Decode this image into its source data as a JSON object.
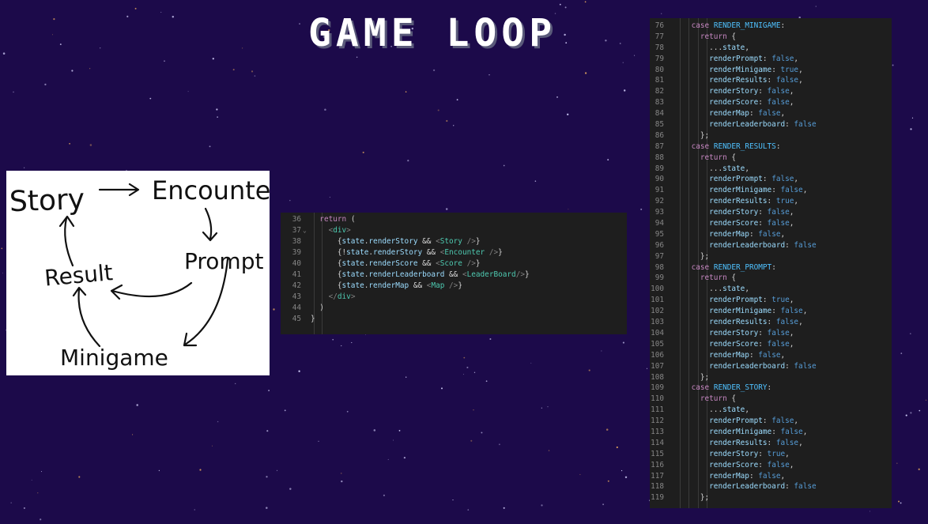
{
  "slide": {
    "title": "GAME LOOP"
  },
  "sketch": {
    "labels": {
      "story": "Story",
      "encounter": "Encounter",
      "prompt": "Prompt",
      "result": "Result",
      "minigame": "Minigame"
    }
  },
  "snippet_small": {
    "lines": [
      {
        "n": "36",
        "t": "  return ("
      },
      {
        "n": "37",
        "t": "    <div>"
      },
      {
        "n": "38",
        "t": "      {state.renderStory && <Story />}"
      },
      {
        "n": "39",
        "t": "      {!state.renderStory && <Encounter />}"
      },
      {
        "n": "40",
        "t": "      {state.renderScore && <Score />}"
      },
      {
        "n": "41",
        "t": "      {state.renderLeaderboard && <LeaderBoard/>}"
      },
      {
        "n": "42",
        "t": "      {state.renderMap && <Map />}"
      },
      {
        "n": "43",
        "t": "    </div>"
      },
      {
        "n": "44",
        "t": "  )"
      },
      {
        "n": "45",
        "t": "}"
      }
    ]
  },
  "snippet_large": {
    "lines": [
      {
        "n": "76",
        "t": "    case RENDER_MINIGAME:"
      },
      {
        "n": "77",
        "t": "      return {"
      },
      {
        "n": "78",
        "t": "        ...state,"
      },
      {
        "n": "79",
        "t": "        renderPrompt: false,"
      },
      {
        "n": "80",
        "t": "        renderMinigame: true,"
      },
      {
        "n": "81",
        "t": "        renderResults: false,"
      },
      {
        "n": "82",
        "t": "        renderStory: false,"
      },
      {
        "n": "83",
        "t": "        renderScore: false,"
      },
      {
        "n": "84",
        "t": "        renderMap: false,"
      },
      {
        "n": "85",
        "t": "        renderLeaderboard: false"
      },
      {
        "n": "86",
        "t": "      };"
      },
      {
        "n": "87",
        "t": "    case RENDER_RESULTS:"
      },
      {
        "n": "88",
        "t": "      return {"
      },
      {
        "n": "89",
        "t": "        ...state,"
      },
      {
        "n": "90",
        "t": "        renderPrompt: false,"
      },
      {
        "n": "91",
        "t": "        renderMinigame: false,"
      },
      {
        "n": "92",
        "t": "        renderResults: true,"
      },
      {
        "n": "93",
        "t": "        renderStory: false,"
      },
      {
        "n": "94",
        "t": "        renderScore: false,"
      },
      {
        "n": "95",
        "t": "        renderMap: false,"
      },
      {
        "n": "96",
        "t": "        renderLeaderboard: false"
      },
      {
        "n": "97",
        "t": "      };"
      },
      {
        "n": "98",
        "t": "    case RENDER_PROMPT:"
      },
      {
        "n": "99",
        "t": "      return {"
      },
      {
        "n": "100",
        "t": "        ...state,"
      },
      {
        "n": "101",
        "t": "        renderPrompt: true,"
      },
      {
        "n": "102",
        "t": "        renderMinigame: false,"
      },
      {
        "n": "103",
        "t": "        renderResults: false,"
      },
      {
        "n": "104",
        "t": "        renderStory: false,"
      },
      {
        "n": "105",
        "t": "        renderScore: false,"
      },
      {
        "n": "106",
        "t": "        renderMap: false,"
      },
      {
        "n": "107",
        "t": "        renderLeaderboard: false"
      },
      {
        "n": "108",
        "t": "      };"
      },
      {
        "n": "109",
        "t": "    case RENDER_STORY:"
      },
      {
        "n": "110",
        "t": "      return {"
      },
      {
        "n": "111",
        "t": "        ...state,"
      },
      {
        "n": "112",
        "t": "        renderPrompt: false,"
      },
      {
        "n": "113",
        "t": "        renderMinigame: false,"
      },
      {
        "n": "114",
        "t": "        renderResults: false,"
      },
      {
        "n": "115",
        "t": "        renderStory: true,"
      },
      {
        "n": "116",
        "t": "        renderScore: false,"
      },
      {
        "n": "117",
        "t": "        renderMap: false,"
      },
      {
        "n": "118",
        "t": "        renderLeaderboard: false"
      },
      {
        "n": "119",
        "t": "      };"
      }
    ]
  },
  "colors": {
    "background": "#1c0a4a",
    "code_background": "#1e1e1e",
    "line_number": "#858585",
    "keyword": "#569cd6",
    "control_keyword": "#c586c0",
    "constant": "#4fc1ff",
    "property": "#9cdcfe",
    "jsx_tag": "#4ec9b0",
    "text": "#d4d4d4"
  }
}
